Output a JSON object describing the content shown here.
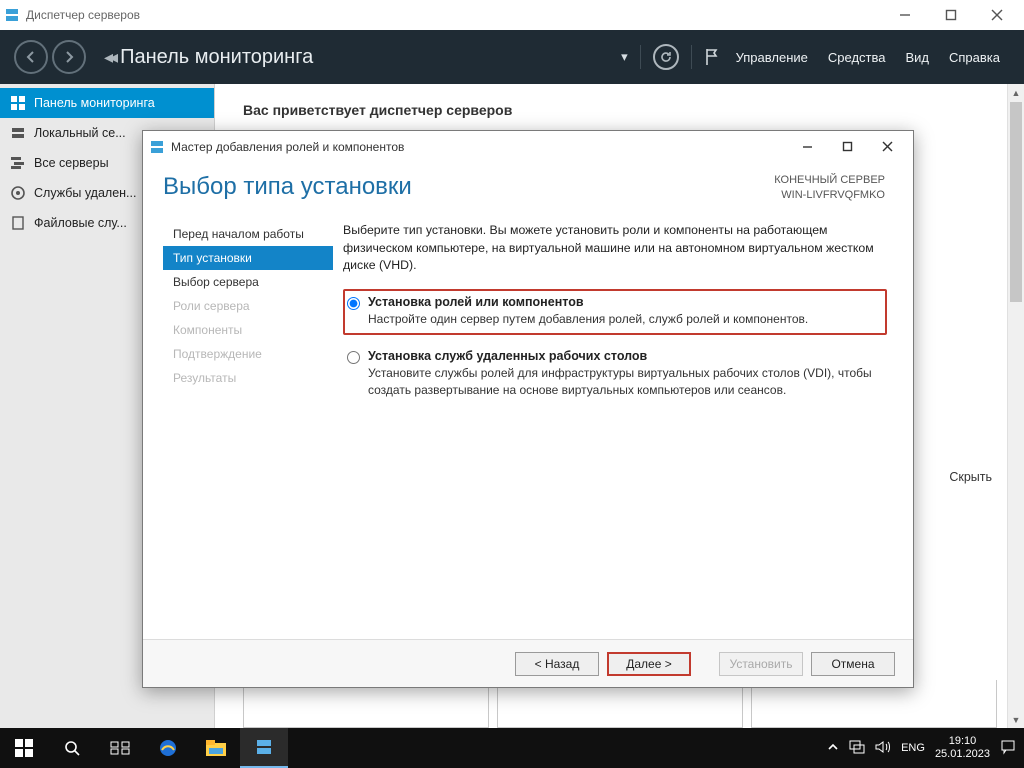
{
  "window": {
    "title": "Диспетчер серверов"
  },
  "header": {
    "title": "Панель мониторинга",
    "menu": {
      "manage": "Управление",
      "tools": "Средства",
      "view": "Вид",
      "help": "Справка"
    }
  },
  "sidebar": {
    "items": [
      {
        "label": "Панель мониторинга"
      },
      {
        "label": "Локальный се..."
      },
      {
        "label": "Все серверы"
      },
      {
        "label": "Службы удален..."
      },
      {
        "label": "Файловые слу..."
      }
    ]
  },
  "main": {
    "welcome": "Вас приветствует диспетчер серверов",
    "hide": "Скрыть"
  },
  "wizard": {
    "title": "Мастер добавления ролей и компонентов",
    "heading": "Выбор типа установки",
    "server_label": "КОНЕЧНЫЙ СЕРВЕР",
    "server_name": "WIN-LIVFRVQFMKO",
    "nav": [
      {
        "label": "Перед началом работы",
        "state": "normal"
      },
      {
        "label": "Тип установки",
        "state": "sel"
      },
      {
        "label": "Выбор сервера",
        "state": "normal"
      },
      {
        "label": "Роли сервера",
        "state": "dis"
      },
      {
        "label": "Компоненты",
        "state": "dis"
      },
      {
        "label": "Подтверждение",
        "state": "dis"
      },
      {
        "label": "Результаты",
        "state": "dis"
      }
    ],
    "intro": "Выберите тип установки. Вы можете установить роли и компоненты на работающем физическом компьютере, на виртуальной машине или на автономном виртуальном жестком диске (VHD).",
    "options": [
      {
        "title": "Установка ролей или компонентов",
        "desc": "Настройте один сервер путем добавления ролей, служб ролей и компонентов.",
        "checked": true,
        "highlight": true
      },
      {
        "title": "Установка служб удаленных рабочих столов",
        "desc": "Установите службы ролей для инфраструктуры виртуальных рабочих столов (VDI), чтобы создать развертывание на основе виртуальных компьютеров или сеансов.",
        "checked": false,
        "highlight": false
      }
    ],
    "buttons": {
      "back": "< Назад",
      "next": "Далее >",
      "install": "Установить",
      "cancel": "Отмена"
    }
  },
  "taskbar": {
    "lang": "ENG",
    "time": "19:10",
    "date": "25.01.2023"
  }
}
